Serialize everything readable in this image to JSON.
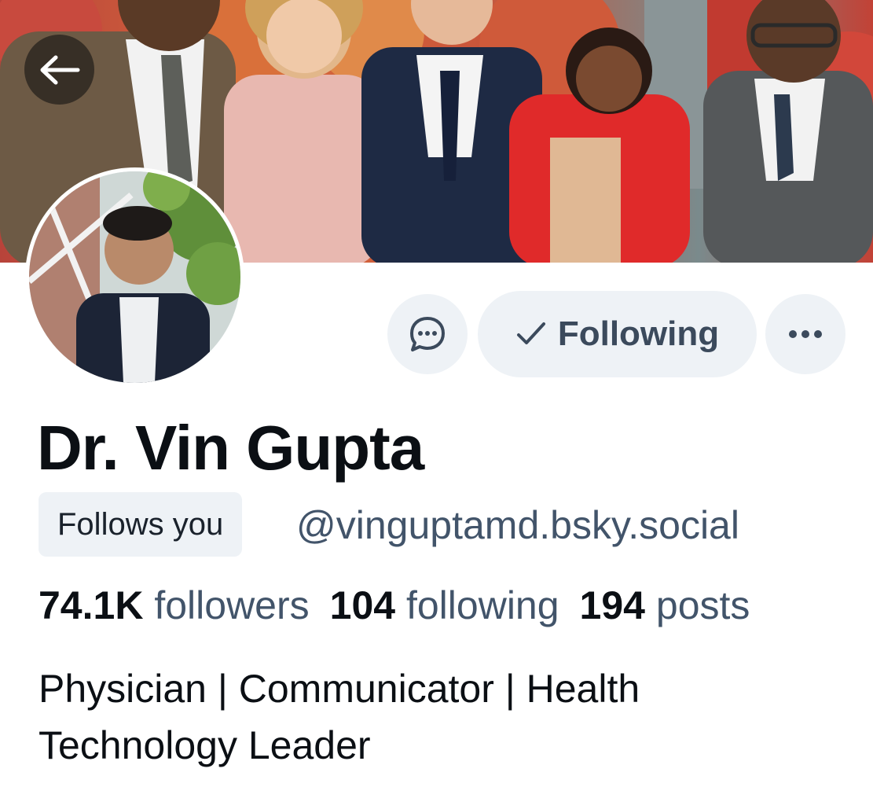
{
  "profile": {
    "display_name": "Dr. Vin Gupta",
    "follows_you_badge": "Follows you",
    "handle": "@vinguptamd.bsky.social",
    "bio": "Physician | Communicator | Health Technology Leader"
  },
  "stats": {
    "followers_count": "74.1K",
    "followers_label": "followers",
    "following_count": "104",
    "following_label": "following",
    "posts_count": "194",
    "posts_label": "posts"
  },
  "actions": {
    "following_button_label": "Following",
    "message_icon": "chat-bubble-icon",
    "more_icon": "ellipsis-icon",
    "back_icon": "arrow-left-icon",
    "check_icon": "check-icon"
  },
  "colors": {
    "button_bg": "#eef2f6",
    "muted_text": "#42546a",
    "primary_text": "#0b0f14"
  }
}
